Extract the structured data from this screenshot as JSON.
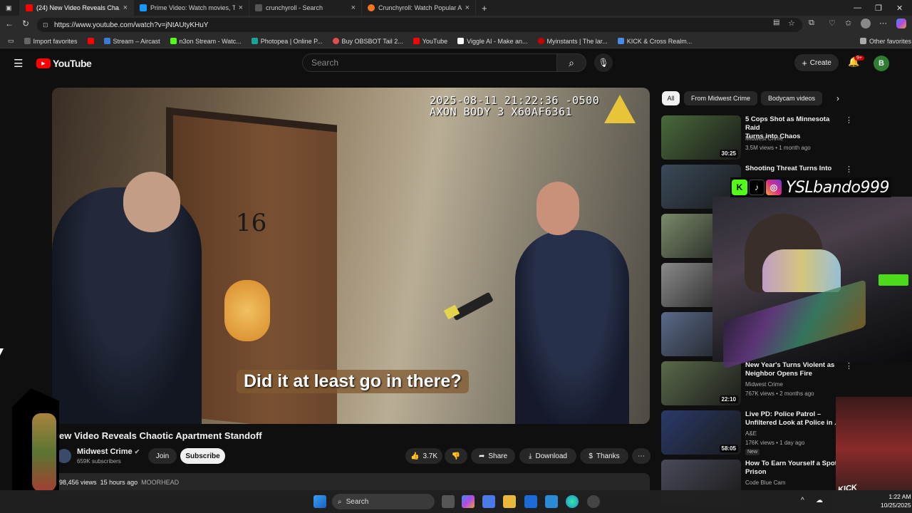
{
  "browser": {
    "tabs": [
      {
        "label": "(24) New Video Reveals Cha...",
        "color": "#ff0000",
        "active": true
      },
      {
        "label": "Prime Video: Watch movies, TV sh...",
        "color": "#1399ff",
        "active": false
      },
      {
        "label": "crunchyroll - Search",
        "color": "#555555",
        "active": false
      },
      {
        "label": "Crunchyroll: Watch Popular Anim...",
        "color": "#f47521",
        "active": false
      }
    ],
    "url": "https://www.youtube.com/watch?v=jNtAUtyKHuY",
    "bookmarks": [
      {
        "label": "Import favorites",
        "color": "#666666"
      },
      {
        "label": "",
        "color": "#ff0000"
      },
      {
        "label": "Stream – Aircast",
        "color": "#3a7bd5"
      },
      {
        "label": "n3on Stream - Watc...",
        "color": "#53fc18"
      },
      {
        "label": "Photopea | Online P...",
        "color": "#18a497"
      },
      {
        "label": "Buy OBSBOT Tail 2...",
        "color": "#e44d4d"
      },
      {
        "label": "YouTube",
        "color": "#ff0000"
      },
      {
        "label": "Viggle AI - Make an...",
        "color": "#ffffff"
      },
      {
        "label": "Myinstants | The lar...",
        "color": "#cc0000"
      },
      {
        "label": "KICK & Cross Realm...",
        "color": "#4a8ae8"
      }
    ],
    "other_favorites": "Other favorites"
  },
  "youtube": {
    "logo_text": "YouTube",
    "search_placeholder": "Search",
    "create_label": "Create",
    "notif_count": "9+",
    "avatar_letter": "B"
  },
  "video": {
    "bodycam_line1": "2025-08-11 21:22:36 -0500",
    "bodycam_line2": "AXON BODY 3 X60AF6361",
    "door_number": "16",
    "caption": "Did it at least go in there?",
    "title": "ew Video Reveals Chaotic Apartment Standoff",
    "channel": "Midwest Crime",
    "subscribers": "659K subscribers",
    "join_label": "Join",
    "subscribe_label": "Subscribe",
    "likes": "3.7K",
    "share_label": "Share",
    "download_label": "Download",
    "thanks_label": "Thanks",
    "views": "98,456 views",
    "age": "15 hours ago",
    "hashtag": "MOORHEAD"
  },
  "chips": [
    "All",
    "From Midwest Crime",
    "Bodycam videos"
  ],
  "recommendations": [
    {
      "title_line1": "5 Cops Shot as Minnesota Raid",
      "title_line2": "Turns into Chaos",
      "channel": "Midwest Crime",
      "meta": "3.5M views • 1 month ago",
      "duration": "30:25",
      "thumb": "#4a6a3a"
    },
    {
      "title_line1": "Shooting Threat Turns Into",
      "title_line2": "",
      "channel": "",
      "meta": "",
      "duration": "",
      "thumb": "#3a4a5a"
    },
    {
      "title_line1": "",
      "title_line2": "",
      "channel": "",
      "meta": "",
      "duration": "",
      "thumb": "#7a8a6a"
    },
    {
      "title_line1": "",
      "title_line2": "",
      "channel": "",
      "meta": "",
      "duration": "",
      "thumb": "#8a8a8a"
    },
    {
      "title_line1": "",
      "title_line2": "",
      "channel": "",
      "meta": "",
      "duration": "",
      "thumb": "#5a6a8a"
    },
    {
      "title_line1": "New Year's Turns Violent as",
      "title_line2": "Neighbor Opens Fire",
      "channel": "Midwest Crime",
      "meta": "767K views • 2 months ago",
      "duration": "22:10",
      "thumb": "#5a6a4a"
    },
    {
      "title_line1": "Live PD: Police Patrol –",
      "title_line2": "Unfiltered Look at Police in ...",
      "channel": "A&E",
      "meta": "176K views • 1 day ago",
      "duration": "58:05",
      "thumb": "#2a3a6a",
      "badge": "New"
    },
    {
      "title_line1": "How To Earn Yourself a Spot in",
      "title_line2": "Prison",
      "channel": "Code Blue Cam",
      "meta": "",
      "duration": "",
      "thumb": "#4a4a5a"
    }
  ],
  "stream_overlay": {
    "handle": "YSLbando999",
    "right_cam_text": "KICK"
  },
  "taskbar": {
    "search_label": "Search",
    "time": "1:22 AM",
    "date": "10/25/2025"
  }
}
